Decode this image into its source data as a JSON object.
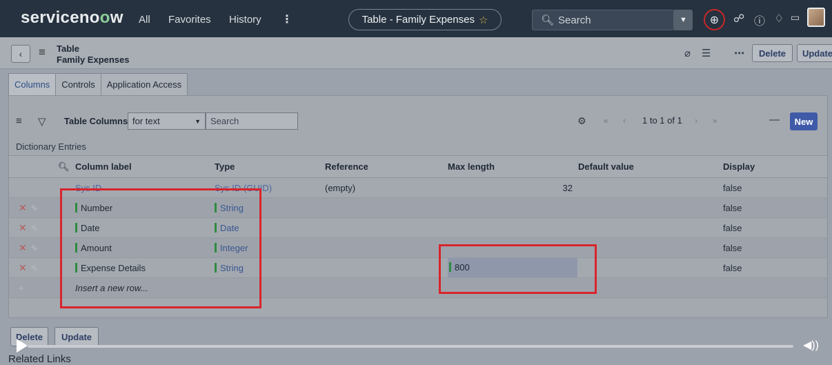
{
  "nav": {
    "logo_pre": "serviceno",
    "logo_o": "o",
    "logo_post": "w",
    "all": "All",
    "favorites": "Favorites",
    "history": "History",
    "kebab": "⋮",
    "title": "Table - Family Expenses",
    "search_placeholder": "Search"
  },
  "header": {
    "line1": "Table",
    "line2": "Family Expenses",
    "delete_label": "Delete",
    "update_label": "Update"
  },
  "tabs": [
    "Columns",
    "Controls",
    "Application Access"
  ],
  "list": {
    "title": "Table Columns",
    "filter_value": "for text",
    "search_placeholder": "Search",
    "page_count": "1  to 1 of 1",
    "new_label": "New",
    "section_label": "Dictionary Entries"
  },
  "columns": [
    "Column label",
    "Type",
    "Reference",
    "Max length",
    "Default value",
    "Display"
  ],
  "rows": [
    {
      "label": "Sys ID",
      "type": "Sys ID (GUID)",
      "reference": "(empty)",
      "max_length": "32",
      "display": "false"
    },
    {
      "label": "Number",
      "type": "String",
      "reference": "",
      "max_length": "",
      "display": "false"
    },
    {
      "label": "Date",
      "type": "Date",
      "reference": "",
      "max_length": "",
      "display": "false"
    },
    {
      "label": "Amount",
      "type": "Integer",
      "reference": "",
      "max_length": "",
      "display": "false"
    },
    {
      "label": "Expense Details",
      "type": "String",
      "reference": "",
      "max_length": "800",
      "display": "false"
    }
  ],
  "insert_row": "Insert a new row...",
  "bottom": {
    "delete_label": "Delete",
    "update_label": "Update",
    "related_links": "Related Links"
  },
  "colors": {
    "topbar": "#26323f",
    "accent_new": "#3e5aa8",
    "highlight_border": "#d9242b",
    "field_marker": "#2e8b3f"
  }
}
